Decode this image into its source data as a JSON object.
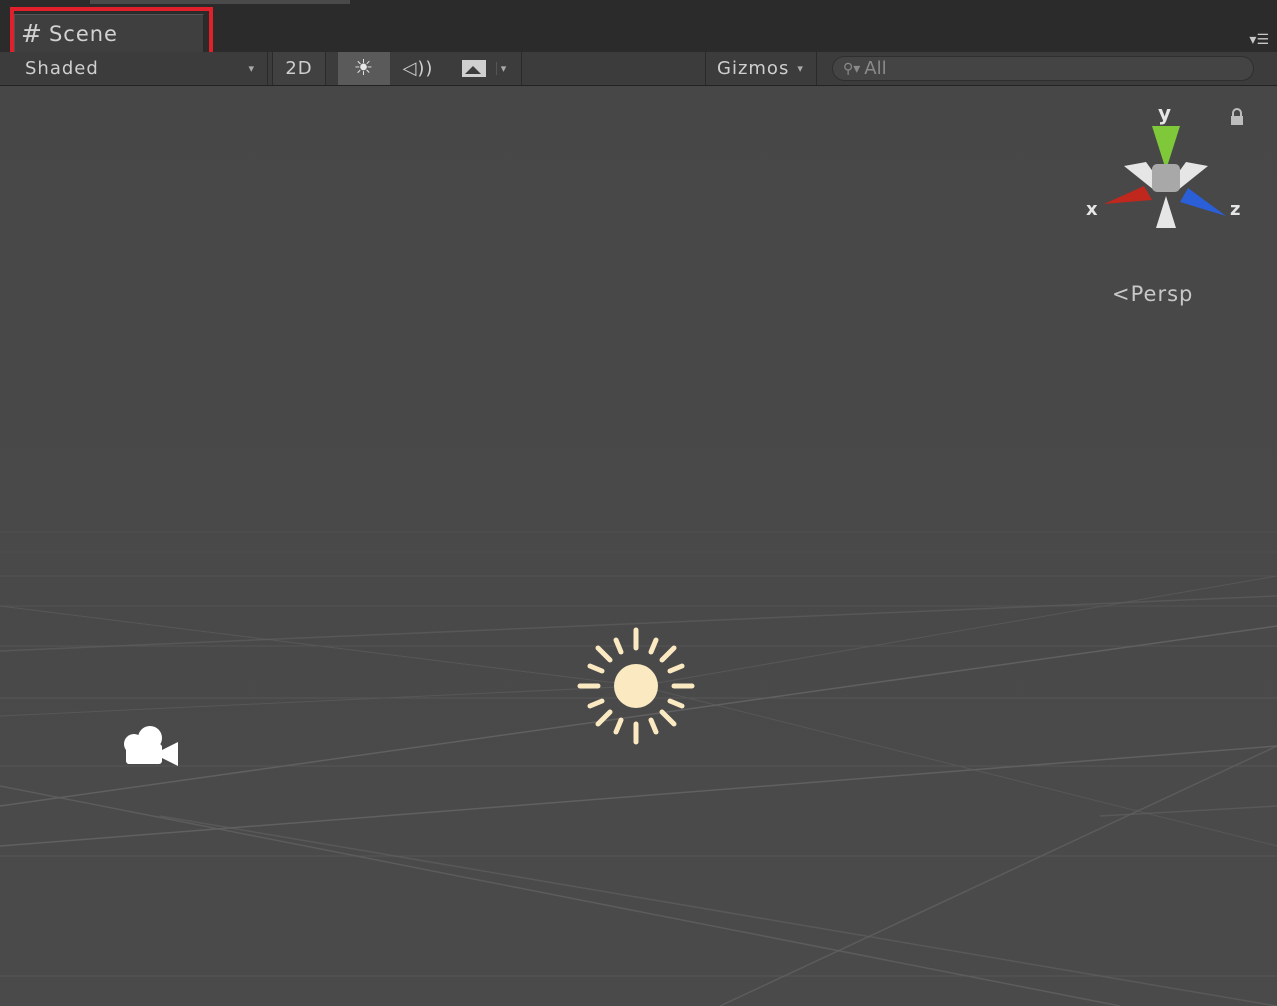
{
  "tab": {
    "icon": "scene-grid-icon",
    "label": "Scene"
  },
  "window_menu_icon": "window-menu-icon",
  "toolbar": {
    "shading_mode": "Shaded",
    "btn_2d": "2D",
    "lighting_icon": "sun-icon",
    "audio_icon": "speaker-icon",
    "effects_icon": "image-icon",
    "gizmos_label": "Gizmos",
    "search_value": "All",
    "search_icon": "search-icon"
  },
  "scene_gizmo": {
    "y_label": "y",
    "x_label": "x",
    "z_label": "z",
    "projection_label": "Persp",
    "colors": {
      "y": "#7ec83a",
      "x": "#c0281e",
      "z": "#2a5fd8",
      "neutral": "#e6e6e6"
    }
  },
  "viewport": {
    "lock_icon": "lock-icon",
    "directional_light_icon": "directional-light-icon",
    "camera_icon": "camera-icon"
  },
  "colors": {
    "highlight": "#e0202a",
    "background": "#474747",
    "light_gizmo": "#fbe9c2"
  }
}
